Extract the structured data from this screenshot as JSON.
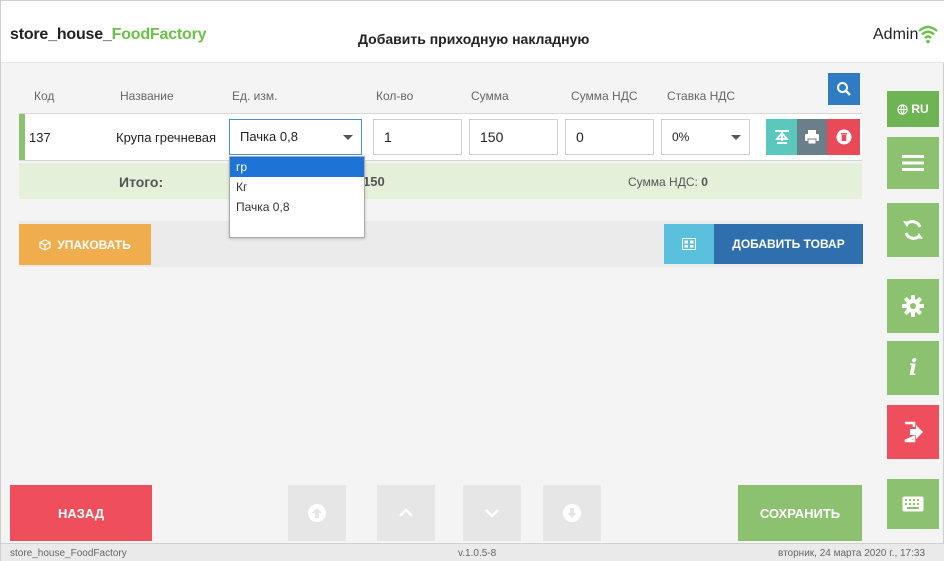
{
  "header": {
    "brand_part1": "store_house_",
    "brand_part2": "FoodFactory",
    "title": "Добавить приходную накладную",
    "user": "Admin"
  },
  "table": {
    "columns": [
      "Код",
      "Название",
      "Ед. изм.",
      "Кол-во",
      "Сумма",
      "Сумма НДС",
      "Ставка НДС"
    ],
    "row": {
      "code": "137",
      "name": "Крупа гречневая",
      "unit": "Пачка 0,8",
      "qty": "1",
      "sum": "150",
      "vat_sum": "0",
      "vat_rate": "0%"
    }
  },
  "dropdown": {
    "options": [
      "гр",
      "Кг",
      "Пачка 0,8"
    ],
    "selected_index": 0
  },
  "total": {
    "label": "Итого:",
    "sum": "150",
    "vat_label": "Сумма НДС:",
    "vat_value": "0"
  },
  "toolbar": {
    "pack_label": "УПАКОВАТЬ",
    "add_label": "ДОБАВИТЬ ТОВАР"
  },
  "sidebar": {
    "lang": "RU"
  },
  "bottom": {
    "back_label": "НАЗАД",
    "save_label": "СОХРАНИТЬ"
  },
  "footer": {
    "app": "store_house_FoodFactory",
    "version": "v.1.0.5-8",
    "datetime": "вторник, 24 марта 2020 г., 17:33"
  },
  "colors": {
    "brand_green": "#6cc04a",
    "primary_blue": "#2f7cc3",
    "danger_red": "#ef4f5c",
    "sidebar_green": "#8cc16f",
    "warning_orange": "#f0ad4e"
  }
}
